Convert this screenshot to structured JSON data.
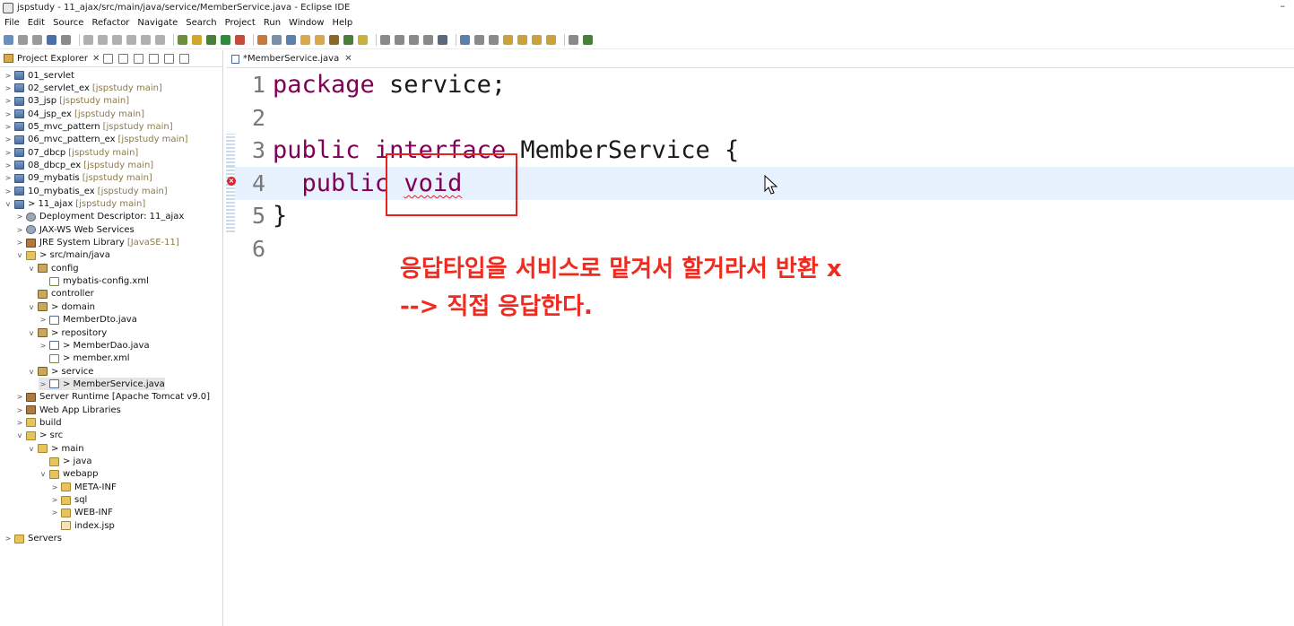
{
  "window": {
    "title": "jspstudy - 11_ajax/src/main/java/service/MemberService.java - Eclipse IDE",
    "minimize_glyph": "–"
  },
  "menu": [
    "File",
    "Edit",
    "Source",
    "Refactor",
    "Navigate",
    "Search",
    "Project",
    "Run",
    "Window",
    "Help"
  ],
  "explorer": {
    "tab_label": "Project Explorer",
    "close_glyph": "✕",
    "tree": [
      {
        "label": "01_servlet",
        "decor": "",
        "chev": ">",
        "icon": "project"
      },
      {
        "label": "02_servlet_ex",
        "decor": "[jspstudy main]",
        "chev": ">",
        "icon": "project"
      },
      {
        "label": "03_jsp",
        "decor": "[jspstudy main]",
        "chev": ">",
        "icon": "project"
      },
      {
        "label": "04_jsp_ex",
        "decor": "[jspstudy main]",
        "chev": ">",
        "icon": "project"
      },
      {
        "label": "05_mvc_pattern",
        "decor": "[jspstudy main]",
        "chev": ">",
        "icon": "project"
      },
      {
        "label": "06_mvc_pattern_ex",
        "decor": "[jspstudy main]",
        "chev": ">",
        "icon": "project"
      },
      {
        "label": "07_dbcp",
        "decor": "[jspstudy main]",
        "chev": ">",
        "icon": "project"
      },
      {
        "label": "08_dbcp_ex",
        "decor": "[jspstudy main]",
        "chev": ">",
        "icon": "project"
      },
      {
        "label": "09_mybatis",
        "decor": "[jspstudy main]",
        "chev": ">",
        "icon": "project"
      },
      {
        "label": "10_mybatis_ex",
        "decor": "[jspstudy main]",
        "chev": ">",
        "icon": "project"
      },
      {
        "label": "> 11_ajax",
        "decor": "[jspstudy main]",
        "chev": "v",
        "icon": "project"
      },
      {
        "label": "Deployment Descriptor: 11_ajax",
        "decor": "",
        "chev": ">",
        "icon": "gear"
      },
      {
        "label": "JAX-WS Web Services",
        "decor": "",
        "chev": ">",
        "icon": "gear"
      },
      {
        "label": "JRE System Library",
        "decor": "[JavaSE-11]",
        "chev": ">",
        "icon": "lib"
      },
      {
        "label": "> src/main/java",
        "decor": "",
        "chev": "v",
        "icon": "folder"
      },
      {
        "label": "config",
        "decor": "",
        "chev": "v",
        "icon": "package"
      },
      {
        "label": "mybatis-config.xml",
        "decor": "",
        "chev": "",
        "icon": "xml"
      },
      {
        "label": "controller",
        "decor": "",
        "chev": "",
        "icon": "package"
      },
      {
        "label": "> domain",
        "decor": "",
        "chev": "v",
        "icon": "package"
      },
      {
        "label": "MemberDto.java",
        "decor": "",
        "chev": ">",
        "icon": "java"
      },
      {
        "label": "> repository",
        "decor": "",
        "chev": "v",
        "icon": "package"
      },
      {
        "label": "> MemberDao.java",
        "decor": "",
        "chev": ">",
        "icon": "java"
      },
      {
        "label": "> member.xml",
        "decor": "",
        "chev": "",
        "icon": "xml"
      },
      {
        "label": "> service",
        "decor": "",
        "chev": "v",
        "icon": "package"
      },
      {
        "label": "> MemberService.java",
        "decor": "",
        "chev": ">",
        "icon": "java"
      },
      {
        "label": "Server Runtime [Apache Tomcat v9.0]",
        "decor": "",
        "chev": ">",
        "icon": "lib"
      },
      {
        "label": "Web App Libraries",
        "decor": "",
        "chev": ">",
        "icon": "lib"
      },
      {
        "label": "build",
        "decor": "",
        "chev": ">",
        "icon": "folder"
      },
      {
        "label": "> src",
        "decor": "",
        "chev": "v",
        "icon": "folder"
      },
      {
        "label": "> main",
        "decor": "",
        "chev": "v",
        "icon": "folder"
      },
      {
        "label": "> java",
        "decor": "",
        "chev": "",
        "icon": "folder"
      },
      {
        "label": "webapp",
        "decor": "",
        "chev": "v",
        "icon": "folder"
      },
      {
        "label": "META-INF",
        "decor": "",
        "chev": ">",
        "icon": "folder"
      },
      {
        "label": "sql",
        "decor": "",
        "chev": ">",
        "icon": "folder"
      },
      {
        "label": "WEB-INF",
        "decor": "",
        "chev": ">",
        "icon": "folder"
      },
      {
        "label": "index.jsp",
        "decor": "",
        "chev": "",
        "icon": "jsp"
      },
      {
        "label": "Servers",
        "decor": "",
        "chev": ">",
        "icon": "folder"
      }
    ],
    "selected_item": "> MemberService.java"
  },
  "editor": {
    "tab_label": "*MemberService.java",
    "close_glyph": "✕",
    "lines": [
      {
        "no": "1",
        "parts": [
          {
            "t": "package",
            "kw": true
          },
          {
            "t": " service;",
            "kw": false
          }
        ]
      },
      {
        "no": "2",
        "parts": []
      },
      {
        "no": "3",
        "parts": [
          {
            "t": "public",
            "kw": true
          },
          {
            "t": " ",
            "kw": false
          },
          {
            "t": "interface",
            "kw": true
          },
          {
            "t": " MemberService {",
            "kw": false
          }
        ]
      },
      {
        "no": "4",
        "parts": [
          {
            "t": "  public",
            "kw": true
          },
          {
            "t": " ",
            "kw": false
          },
          {
            "t": "void",
            "kw": true,
            "err": true
          }
        ]
      },
      {
        "no": "5",
        "parts": [
          {
            "t": "}",
            "kw": false
          }
        ]
      },
      {
        "no": "6",
        "parts": []
      }
    ],
    "current_line": "4",
    "error_line": "4"
  },
  "annotation": {
    "line1": "응답타입을 서비스로 맡겨서 할거라서 반환 x",
    "line2": "--> 직접 응답한다."
  },
  "colors": {
    "keyword": "#7f0055",
    "annotation": "#ef2a1f",
    "current_line": "#e8f2fe"
  }
}
